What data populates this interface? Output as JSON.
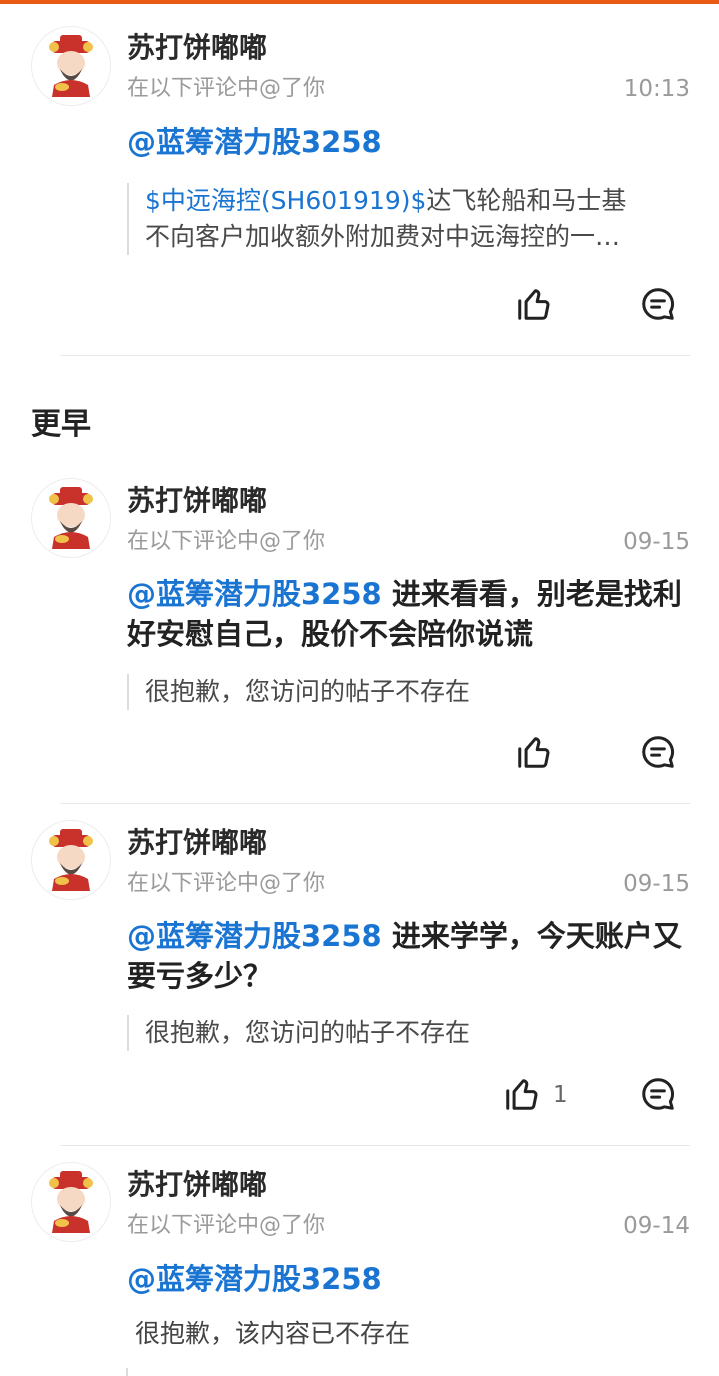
{
  "colors": {
    "accent_top_bar": "#ea5a13",
    "mention": "#1a74d2"
  },
  "icons": {
    "avatar": "caishen-avatar-icon",
    "like": "thumbs-up-icon",
    "comment": "comment-bubble-icon"
  },
  "section_earlier": "更早",
  "items": [
    {
      "user": "苏打饼嘟嘟",
      "subtitle": "在以下评论中@了你",
      "time": "10:13",
      "mention": "@蓝筹潜力股3258",
      "text": "",
      "quote_stock": "$中远海控(SH601919)$",
      "quote_rest": "达飞轮船和马士基",
      "quote_line2": "不向客户加收额外附加费对中远海控的一…",
      "like_count": ""
    },
    {
      "user": "苏打饼嘟嘟",
      "subtitle": "在以下评论中@了你",
      "time": "09-15",
      "mention": "@蓝筹潜力股3258",
      "text": " 进来看看，别老是找利好安慰自己，股价不会陪你说谎",
      "deleted": "很抱歉，您访问的帖子不存在",
      "like_count": ""
    },
    {
      "user": "苏打饼嘟嘟",
      "subtitle": "在以下评论中@了你",
      "time": "09-15",
      "mention": "@蓝筹潜力股3258",
      "text": " 进来学学，今天账户又要亏多少？",
      "deleted": "很抱歉，您访问的帖子不存在",
      "like_count": "1"
    },
    {
      "user": "苏打饼嘟嘟",
      "subtitle": "在以下评论中@了你",
      "time": "09-14",
      "mention": "@蓝筹潜力股3258",
      "text": "",
      "deleted": "很抱歉，该内容已不存在",
      "like_count": ""
    }
  ]
}
